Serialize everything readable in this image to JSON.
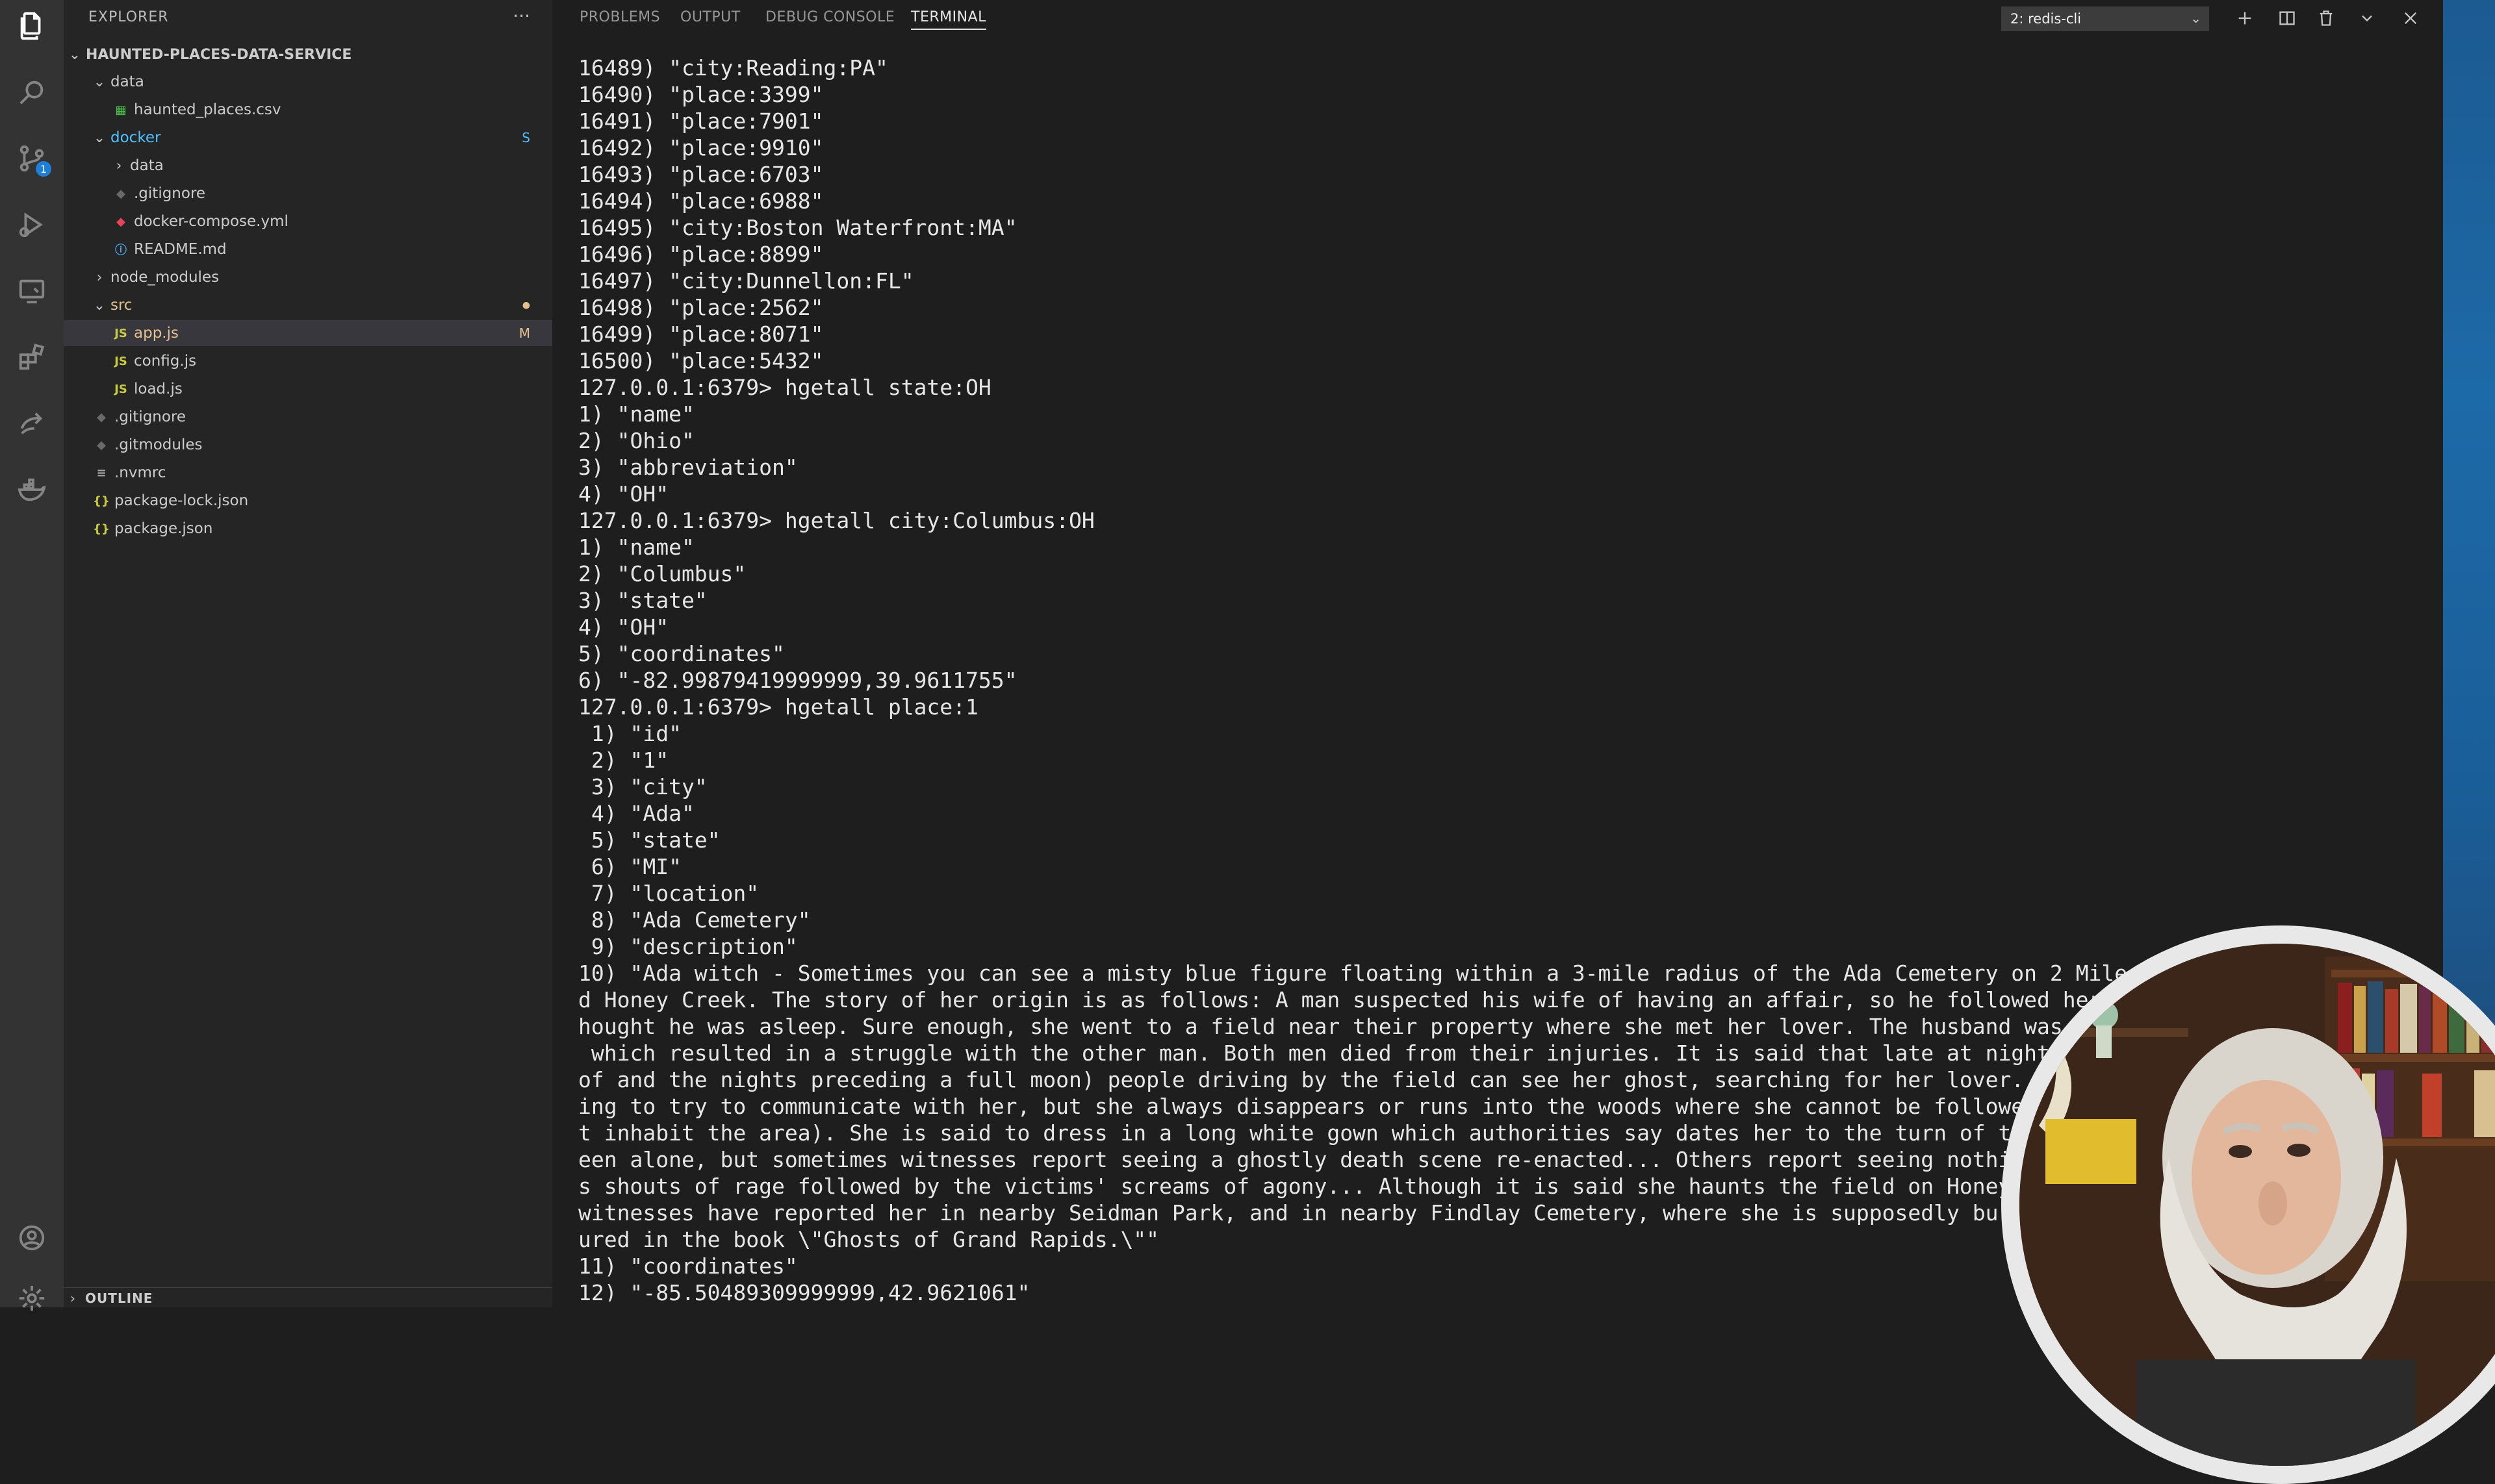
{
  "explorer": {
    "title": "EXPLORER",
    "more": "···",
    "tree": [
      {
        "label": "HAUNTED-PLACES-DATA-SERVICE",
        "kind": "root",
        "chevron": "⌄",
        "color": "#cccccc"
      },
      {
        "label": "data",
        "kind": "folder",
        "chevron": "⌄",
        "color": "#cccccc"
      },
      {
        "label": "haunted_places.csv",
        "kind": "csv",
        "color": "#cccccc"
      },
      {
        "label": "docker",
        "kind": "folder",
        "chevron": "⌄",
        "color": "#4fc1ff",
        "badge": "S"
      },
      {
        "label": "data",
        "kind": "folder",
        "chevron": "›",
        "color": "#cccccc"
      },
      {
        "label": ".gitignore",
        "kind": "git",
        "color": "#cccccc"
      },
      {
        "label": "docker-compose.yml",
        "kind": "docker",
        "color": "#cccccc"
      },
      {
        "label": "README.md",
        "kind": "info",
        "color": "#cccccc"
      },
      {
        "label": "node_modules",
        "kind": "folder",
        "chevron": "›",
        "color": "#cccccc"
      },
      {
        "label": "src",
        "kind": "folder",
        "chevron": "⌄",
        "color": "#e2c08d",
        "badge": "●"
      },
      {
        "label": "app.js",
        "kind": "js",
        "color": "#e2c08d",
        "badge": "M"
      },
      {
        "label": "config.js",
        "kind": "js",
        "color": "#cccccc"
      },
      {
        "label": "load.js",
        "kind": "js",
        "color": "#cccccc"
      },
      {
        "label": ".gitignore",
        "kind": "git",
        "color": "#cccccc"
      },
      {
        "label": ".gitmodules",
        "kind": "git",
        "color": "#cccccc"
      },
      {
        "label": ".nvmrc",
        "kind": "nvmrc",
        "color": "#cccccc"
      },
      {
        "label": "package-lock.json",
        "kind": "json",
        "color": "#cccccc"
      },
      {
        "label": "package.json",
        "kind": "json",
        "color": "#cccccc"
      }
    ],
    "outline_label": "OUTLINE"
  },
  "icons": {
    "activity": [
      "files-icon",
      "search-icon",
      "source-control-icon",
      "run-debug-icon",
      "remote-explorer-icon",
      "extensions-icon",
      "live-share-icon",
      "docker-icon",
      "account-icon",
      "settings-gear-icon"
    ],
    "source_control_badge": "1"
  },
  "panel": {
    "tabs": [
      "PROBLEMS",
      "OUTPUT",
      "DEBUG CONSOLE",
      "TERMINAL"
    ],
    "active_tab": "TERMINAL",
    "terminal_select": "2: redis-cli",
    "buttons": [
      "new-terminal-icon",
      "split-terminal-icon",
      "kill-terminal-icon",
      "maximize-panel-icon",
      "close-panel-icon"
    ]
  },
  "terminal": {
    "lines": [
      "16489) \"city:Reading:PA\"",
      "16490) \"place:3399\"",
      "16491) \"place:7901\"",
      "16492) \"place:9910\"",
      "16493) \"place:6703\"",
      "16494) \"place:6988\"",
      "16495) \"city:Boston Waterfront:MA\"",
      "16496) \"place:8899\"",
      "16497) \"city:Dunnellon:FL\"",
      "16498) \"place:2562\"",
      "16499) \"place:8071\"",
      "16500) \"place:5432\"",
      "127.0.0.1:6379> hgetall state:OH",
      "1) \"name\"",
      "2) \"Ohio\"",
      "3) \"abbreviation\"",
      "4) \"OH\"",
      "127.0.0.1:6379> hgetall city:Columbus:OH",
      "1) \"name\"",
      "2) \"Columbus\"",
      "3) \"state\"",
      "4) \"OH\"",
      "5) \"coordinates\"",
      "6) \"-82.99879419999999,39.9611755\"",
      "127.0.0.1:6379> hgetall place:1",
      " 1) \"id\"",
      " 2) \"1\"",
      " 3) \"city\"",
      " 4) \"Ada\"",
      " 5) \"state\"",
      " 6) \"MI\"",
      " 7) \"location\"",
      " 8) \"Ada Cemetery\"",
      " 9) \"description\"",
      "10) \"Ada witch - Sometimes you can see a misty blue figure floating within a 3-mile radius of the Ada Cemetery on 2 Mile be",
      "d Honey Creek. The story of her origin is as follows: A man suspected his wife of having an affair, so he followed her l",
      "hought he was asleep. Sure enough, she went to a field near their property where she met her lover. The husband was en",
      " which resulted in a struggle with the other man. Both men died from their injuries. It is said that late at night (",
      "of and the nights preceding a full moon) people driving by the field can see her ghost, searching for her lover. So",
      "ing to try to communicate with her, but she always disappears or runs into the woods where she cannot be followed",
      "t inhabit the area). She is said to dress in a long white gown which authorities say dates her to the turn of the",
      "een alone, but sometimes witnesses report seeing a ghostly death scene re-enacted... Others report seeing nothing",
      "s shouts of rage followed by the victims' screams of agony... Although it is said she haunts the field on Honeyc",
      "witnesses have reported her in nearby Seidman Park, and in nearby Findlay Cemetery, where she is supposedly buri",
      "ured in the book \\\"Ghosts of Grand Rapids.\\\"\"",
      "11) \"coordinates\"",
      "12) \"-85.50489309999999,42.9621061\""
    ]
  },
  "colors": {
    "activity_bar": "#333333",
    "sidebar": "#252526",
    "panel": "#1e1e1e",
    "accent": "#1f7fd4",
    "modified": "#e2c08d",
    "folder_highlight": "#4fc1ff"
  }
}
